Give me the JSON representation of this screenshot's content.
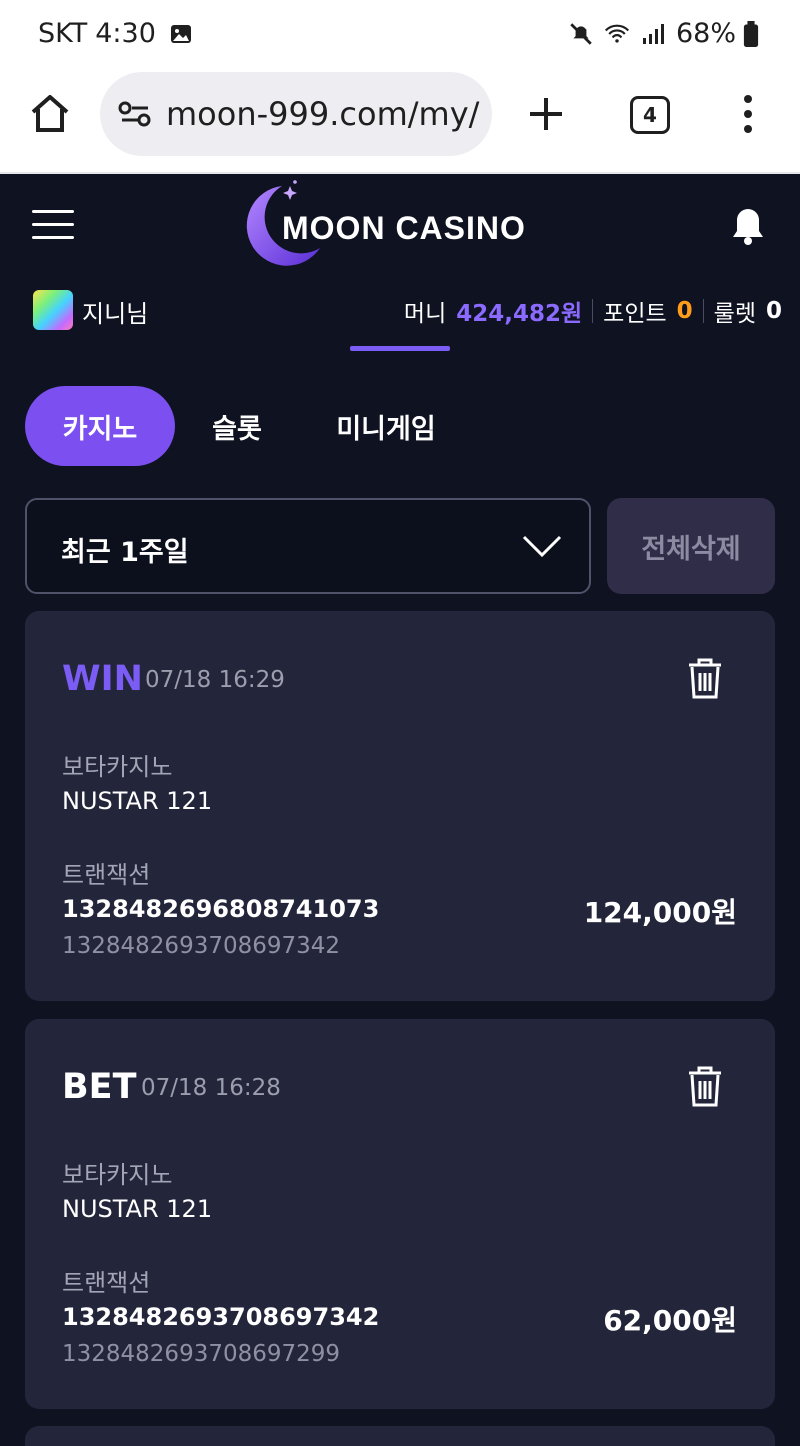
{
  "statusbar": {
    "carrier": "SKT",
    "time": "4:30",
    "battery": "68%",
    "icons": [
      "gallery-icon",
      "mute-icon",
      "wifi-icon",
      "signal-icon",
      "battery-icon"
    ]
  },
  "browser": {
    "url": "moon-999.com/my/",
    "tab_count": "4"
  },
  "header": {
    "logo_text": "MOON CASINO"
  },
  "user": {
    "name": "지니님",
    "money_label": "머니",
    "money_value": "424,482원",
    "point_label": "포인트",
    "point_value": "0",
    "roulette_label": "룰렛",
    "roulette_value": "0"
  },
  "tabs": [
    {
      "label": "카지노",
      "active": true
    },
    {
      "label": "슬롯",
      "active": false
    },
    {
      "label": "미니게임",
      "active": false
    }
  ],
  "filter": {
    "selected": "최근 1주일",
    "delete_all_label": "전체삭제"
  },
  "cards": [
    {
      "type": "WIN",
      "type_color": "#7b5cf5",
      "date": "07/18 16:29",
      "provider": "보타카지노",
      "game": "NUSTAR 121",
      "tx_label": "트랜잭션",
      "tx_id": "1328482696808741073",
      "tx_sub": "1328482693708697342",
      "amount": "124,000원"
    },
    {
      "type": "BET",
      "type_color": "#ffffff",
      "date": "07/18 16:28",
      "provider": "보타카지노",
      "game": "NUSTAR 121",
      "tx_label": "트랜잭션",
      "tx_id": "1328482693708697342",
      "tx_sub": "1328482693708697299",
      "amount": "62,000원"
    }
  ],
  "colors": {
    "accent": "#7b4ff0",
    "money": "#8b6bff",
    "point": "#ff9d1a",
    "background": "#0f1220",
    "card": "#23263a"
  }
}
